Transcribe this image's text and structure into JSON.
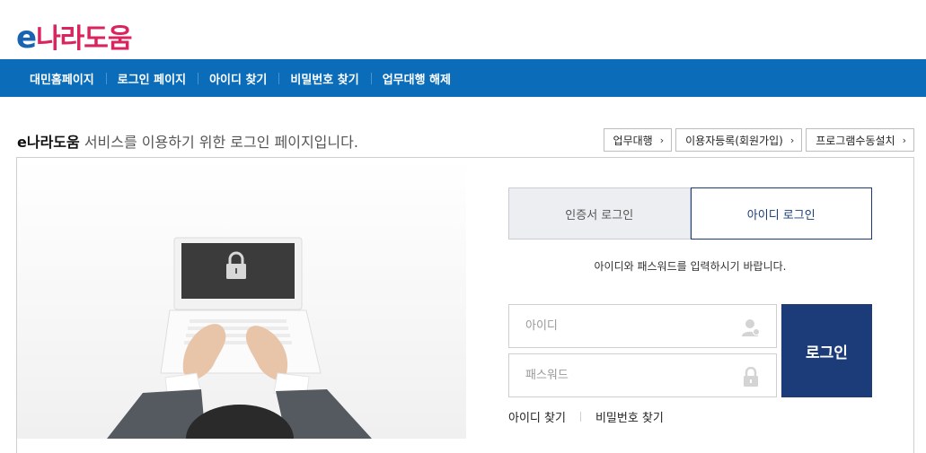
{
  "logo": {
    "e": "e",
    "korean": "나라도움"
  },
  "nav": {
    "items": [
      {
        "label": "대민홈페이지"
      },
      {
        "label": "로그인 페이지"
      },
      {
        "label": "아이디 찾기"
      },
      {
        "label": "비밀번호 찾기"
      },
      {
        "label": "업무대행 해제"
      }
    ]
  },
  "intro": {
    "brand": "e나라도움",
    "text": " 서비스를 이용하기 위한 로그인 페이지입니다."
  },
  "top_buttons": [
    {
      "label": "업무대행",
      "icon": "chevron-right-icon"
    },
    {
      "label": "이용자등록(회원가입)",
      "icon": "chevron-right-icon"
    },
    {
      "label": "프로그램수동설치",
      "icon": "chevron-right-icon"
    }
  ],
  "tabs": {
    "cert": "인증서 로그인",
    "id": "아이디 로그인",
    "active": "id"
  },
  "guide": "아이디와 패스워드를 입력하시기 바랍니다.",
  "form": {
    "id_placeholder": "아이디",
    "id_value": "",
    "pw_placeholder": "패스워드",
    "pw_value": "",
    "login_label": "로그인"
  },
  "links": {
    "find_id": "아이디 찾기",
    "find_pw": "비밀번호 찾기"
  },
  "colors": {
    "nav_bg": "#0b6dba",
    "primary": "#1b3c79",
    "logo_blue": "#1a63b0",
    "logo_pink": "#d9245e"
  }
}
